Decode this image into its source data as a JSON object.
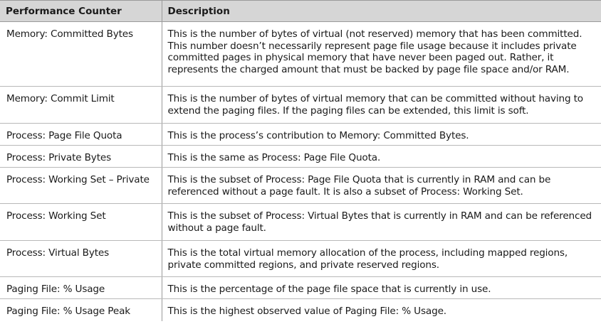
{
  "table": {
    "headers": {
      "counter": "Performance Counter",
      "description": "Description"
    },
    "rows": [
      {
        "counter": "Memory: Committed Bytes",
        "description": "This is the number of bytes of virtual (not reserved) memory that has been committed. This number doesn’t necessarily represent page file usage because it includes private committed pages in physical memory that have never been paged out. Rather, it represents the charged amount that must be backed by page file space and/or RAM."
      },
      {
        "counter": "Memory: Commit Limit",
        "description": "This is the number of bytes of virtual memory that can be committed without having to extend the paging files. If the paging files can be extended, this limit is soft."
      },
      {
        "counter": "Process: Page File Quota",
        "description": "This is the process’s contribution to Memory: Committed Bytes."
      },
      {
        "counter": "Process: Private Bytes",
        "description": "This is the same as Process: Page File Quota."
      },
      {
        "counter": "Process: Working Set – Private",
        "description": "This is the subset of Process: Page File Quota that is currently in RAM and can be referenced without a page fault. It is also a subset of Process: Working Set."
      },
      {
        "counter": "Process: Working Set",
        "description": "This is the subset of Process: Virtual Bytes that is currently in RAM and can be referenced without a page fault."
      },
      {
        "counter": "Process: Virtual Bytes",
        "description": "This is the total virtual memory allocation of the process, including mapped regions, private committed regions, and private reserved regions."
      },
      {
        "counter": "Paging File: % Usage",
        "description": "This is the percentage of the page file space that is currently in use."
      },
      {
        "counter": "Paging File: % Usage Peak",
        "description": "This is the highest observed value of Paging File: % Usage."
      }
    ]
  }
}
